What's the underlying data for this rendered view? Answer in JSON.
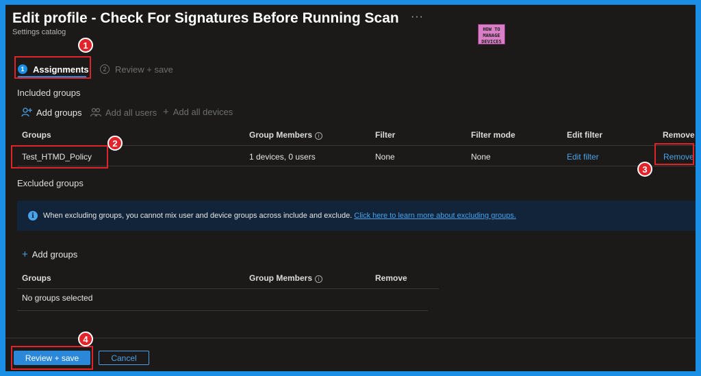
{
  "header": {
    "title": "Edit profile - Check For Signatures Before Running Scan",
    "more": "···",
    "subtitle": "Settings catalog"
  },
  "logo": {
    "line1": "HOW TO",
    "line2": "MANAGE",
    "line3": "DEVICES"
  },
  "tabs": [
    {
      "num": "1",
      "label": "Assignments"
    },
    {
      "num": "2",
      "label": "Review + save"
    }
  ],
  "included": {
    "title": "Included groups",
    "commands": {
      "add_groups": "Add groups",
      "add_all_users": "Add all users",
      "add_all_devices": "Add all devices"
    },
    "columns": {
      "groups": "Groups",
      "members": "Group Members",
      "filter": "Filter",
      "filter_mode": "Filter mode",
      "edit_filter": "Edit filter",
      "remove": "Remove"
    },
    "rows": [
      {
        "group": "Test_HTMD_Policy",
        "members": "1 devices, 0 users",
        "filter": "None",
        "filter_mode": "None",
        "edit_filter": "Edit filter",
        "remove": "Remove"
      }
    ]
  },
  "excluded": {
    "title": "Excluded groups",
    "info_text": "When excluding groups, you cannot mix user and device groups across include and exclude.",
    "info_link": "Click here to learn more about excluding groups.",
    "add_groups": "Add groups",
    "columns": {
      "groups": "Groups",
      "members": "Group Members",
      "remove": "Remove"
    },
    "empty_text": "No groups selected"
  },
  "footer": {
    "review_save": "Review + save",
    "cancel": "Cancel"
  },
  "annotations": [
    "1",
    "2",
    "3",
    "4"
  ],
  "colors": {
    "accent": "#1b8fe6",
    "highlight": "#e0242a",
    "background": "#1b1a19"
  }
}
